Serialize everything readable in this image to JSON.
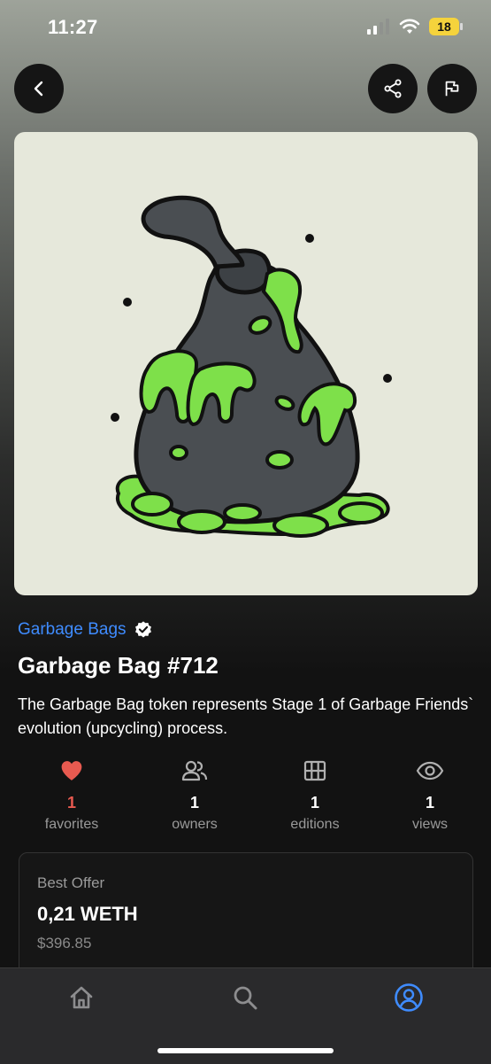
{
  "status_bar": {
    "time": "11:27",
    "battery": "18"
  },
  "collection": {
    "name": "Garbage Bags",
    "verified_icon": "verified-badge-icon"
  },
  "nft": {
    "title": "Garbage Bag #712",
    "description": "The Garbage Bag token represents Stage 1 of Garbage Friends` evolution (upcycling) process."
  },
  "stats": [
    {
      "icon": "heart-icon",
      "count": "1",
      "label": "favorites"
    },
    {
      "icon": "owners-icon",
      "count": "1",
      "label": "owners"
    },
    {
      "icon": "editions-grid-icon",
      "count": "1",
      "label": "editions"
    },
    {
      "icon": "eye-icon",
      "count": "1",
      "label": "views"
    }
  ],
  "offer": {
    "label": "Best Offer",
    "value": "0,21 WETH",
    "usd": "$396.85"
  },
  "colors": {
    "accent": "#3f8cff",
    "heart": "#e85a50",
    "slime": "#7ee04a",
    "bag": "#4a4e52"
  },
  "nav": [
    "home-icon",
    "search-icon",
    "profile-icon"
  ]
}
